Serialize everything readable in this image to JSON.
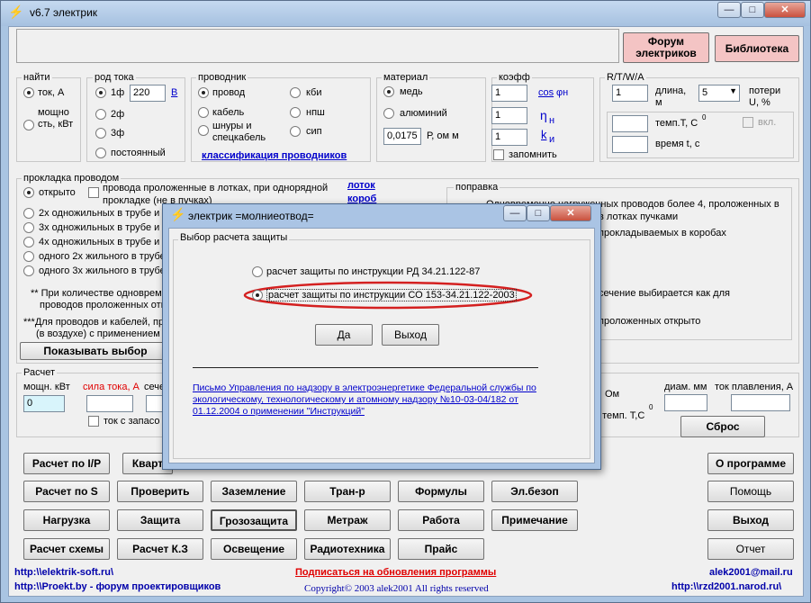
{
  "window": {
    "title": "v6.7 электрик",
    "btn_min": "—",
    "btn_max": "□",
    "btn_close": "✕"
  },
  "top_buttons": {
    "forum": "Форум электриков",
    "library": "Библиотека"
  },
  "find": {
    "label": "найти",
    "opt1": "ток, А",
    "opt2": "мощно сть, кВт"
  },
  "current": {
    "label": "род тока",
    "opt1": "1ф",
    "voltage": "220",
    "unit": "В",
    "opt2": "2ф",
    "opt3": "3ф",
    "opt4": "постоянный"
  },
  "conductor": {
    "label": "проводник",
    "opt_wire": "провод",
    "opt_cable": "кабель",
    "opt_cord": "шнуры и спецкабель",
    "opt_kbi": "кби",
    "opt_nps": "нпш",
    "opt_sip": "сип",
    "classify": "классификация проводников"
  },
  "material": {
    "label": "материал",
    "opt1": "медь",
    "opt2": "алюминий",
    "rho": "0,0175",
    "rho_unit": "Р, ом м"
  },
  "coef": {
    "label": "коэфф",
    "v1": "1",
    "cos": "cos",
    "phi": "φн",
    "v2": "1",
    "eta": "η",
    "eta_sub": "н",
    "v3": "1",
    "k": "k",
    "k_sub": "и",
    "remember": "запомнить"
  },
  "rtwa": {
    "label": "R/T/W/A",
    "len_val": "1",
    "len_label": "длина, м",
    "loss_sel": "5",
    "loss_label": "потери U, %",
    "temp_label": "темп.T, C",
    "temp_sup": "0",
    "on_label": "вкл.",
    "time_label": "время t, c"
  },
  "laying": {
    "label": "прокладка проводом",
    "open": "открыто",
    "tray_check": "провода проложенные в лотках, при однорядной прокладке (не в пучках)",
    "tray_link": "лоток",
    "box_link": "короб",
    "r1": "2х одножильных в трубе и",
    "r2": "3х одножильных в трубе и",
    "r3": "4х одножильных в трубе и",
    "r4": "одного 2х жильного в трубе",
    "r5": "одного 3х жильного в трубе",
    "note1": "** При количестве одновреме",
    "note1b": "проводов проложенных отк",
    "note2": "***Для проводов и кабелей, пр",
    "note2b": "(в воздухе) с применением",
    "show_btn": "Показывать выбор"
  },
  "correction": {
    "label": "поправка",
    "t1": "Одновременно нагруженных проводов более 4, проложенных в",
    "t2": "в лотках пучками",
    "t3": "прокладываемых в коробах",
    "t4": "сечение выбирается как для",
    "t5": "проложенных открыто"
  },
  "calc": {
    "label": "Расчет",
    "power_label": "мощн. кВт",
    "power_val": "0",
    "current_label": "сила тока, А",
    "section_label": "сече",
    "reserve": "ток с запасо",
    "ohm": "Ом",
    "temp": "н темп. T,C",
    "temp_sup": "0",
    "diam": "диам. мм",
    "melt": "ток плавления, А",
    "reset": "Сброс"
  },
  "buttons": {
    "r1": [
      "Расчет по I/P",
      "Кварт",
      "",
      "",
      "",
      "",
      "О программе"
    ],
    "r2": [
      "Расчет по S",
      "Проверить",
      "Заземление",
      "Тран-р",
      "Формулы",
      "Эл.безоп",
      "Помощь"
    ],
    "r3": [
      "Нагрузка",
      "Защита",
      "Грозозащита",
      "Метраж",
      "Работа",
      "Примечание",
      "Выход"
    ],
    "r4": [
      "Расчет схемы",
      "Расчет К.З",
      "Освещение",
      "Радиотехника",
      "Прайс",
      "",
      "Отчет"
    ]
  },
  "footer": {
    "site1": "http:\\\\elektrik-soft.ru\\",
    "subscribe": "Подписаться на обновления программы",
    "mail": "alek2001@mail.ru",
    "site2": "http:\\\\Proekt.by - форум проектировщиков",
    "copyright": "Copyright© 2003 alek2001 All rights reserved",
    "site3": "http:\\\\rzd2001.narod.ru\\"
  },
  "dialog": {
    "title": "электрик =молниеотвод=",
    "group": "Выбор расчета защиты",
    "opt1": "расчет защиты по инструкции РД 34.21.122-87",
    "opt2": "расчет защиты по инструкции СО 153-34.21.122-2003",
    "yes": "Да",
    "exit": "Выход",
    "letter": "Письмо Управления по надзору в электроэнергетике Федеральной службы по экологическому, технологическому и атомному надзору №10-03-04/182 от 01.12.2004 о применении \"Инструкций\""
  },
  "colors": {
    "accent_red": "#e00000",
    "link_blue": "#0000cc",
    "forum_bg": "#f4c4c4",
    "power_field": "#d8f4fb",
    "highlight_ellipse": "#d42020"
  }
}
